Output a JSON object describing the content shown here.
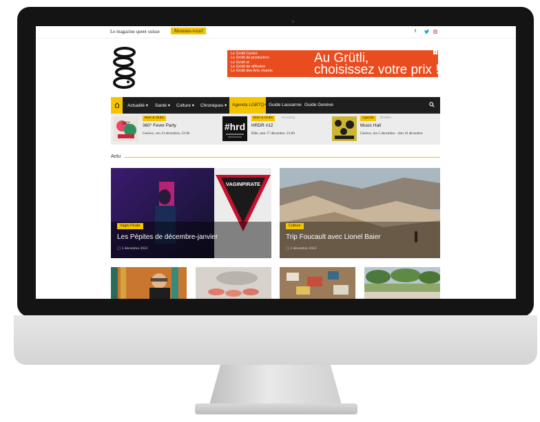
{
  "topbar": {
    "tagline": "Le magazine queer suisse",
    "subscribe": "Abonnez-vous!",
    "social": [
      "f",
      "y",
      "ig"
    ]
  },
  "ad": {
    "small_lines": [
      "Le Grütli Centre",
      "Le Grütli de production",
      "Le Grütli et",
      "Le Grütli de diffusion",
      "Le Grütli des Arts vivants"
    ],
    "headline_1": "Au Grütli,",
    "headline_2": "choisissez votre prix !",
    "close": "x"
  },
  "nav": {
    "items": [
      {
        "label": "Actualité ▾"
      },
      {
        "label": "Santé ▾"
      },
      {
        "label": "Culture ▾"
      },
      {
        "label": "Chroniques ▾"
      },
      {
        "label": "Agenda LGBTQ+"
      },
      {
        "label": "Guide Lausanne"
      },
      {
        "label": "Guide Genève"
      }
    ],
    "home_icon": "home-icon",
    "search_icon": "search-icon"
  },
  "events": [
    {
      "badge": "Bars & Clubs",
      "tag": "",
      "title": "360° Fever Party",
      "date": "Genève, ven 23 décembre, 23:00"
    },
    {
      "badge": "Bars & Clubs",
      "tag": "#cruising",
      "title": "HRDR #12",
      "date": "Bâle, sam 17 décembre, 23:00"
    },
    {
      "badge": "Agenda",
      "tag": "#théâtre",
      "title": "Music Hall",
      "date": "Genève, lun 5 décembre - dim 18 décembre"
    }
  ],
  "section": {
    "label": "Actu"
  },
  "cards": [
    {
      "badge": "Vagin Pirate",
      "title": "Les Pépites de décembre-janvier",
      "date": "5 décembre 2022",
      "overlay_text": "VAGINPIRATE"
    },
    {
      "badge": "Culture",
      "title": "Trip Foucault avec Lionel Baier",
      "date": "2 décembre 2022"
    }
  ],
  "thumb_text": {
    "hrd": "#hrd"
  },
  "colors": {
    "accent": "#f5c400",
    "nav_bg": "#1e1e1e",
    "ad_bg": "#e94c1f"
  }
}
